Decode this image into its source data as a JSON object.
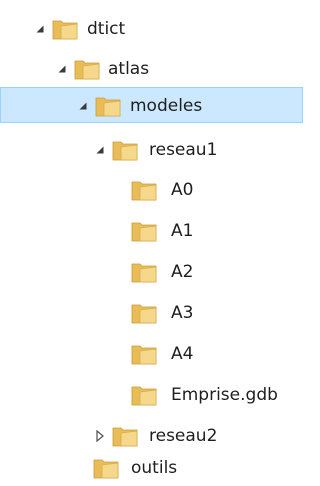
{
  "tree": {
    "colors": {
      "selection_fill": "#cce8ff",
      "selection_border": "#99d1ff",
      "folder": "#e8bd58",
      "folder_front": "#f5d88b",
      "text": "#1e1e1e"
    },
    "items": [
      {
        "label": "dtict",
        "toggle": "expanded",
        "selected": false,
        "icon": "folder-icon"
      },
      {
        "label": "atlas",
        "toggle": "expanded",
        "selected": false,
        "icon": "folder-icon"
      },
      {
        "label": "modeles",
        "toggle": "expanded",
        "selected": true,
        "icon": "folder-icon"
      },
      {
        "label": "reseau1",
        "toggle": "expanded",
        "selected": false,
        "icon": "folder-icon"
      },
      {
        "label": "A0",
        "toggle": "none",
        "selected": false,
        "icon": "folder-icon"
      },
      {
        "label": "A1",
        "toggle": "none",
        "selected": false,
        "icon": "folder-icon"
      },
      {
        "label": "A2",
        "toggle": "none",
        "selected": false,
        "icon": "folder-icon"
      },
      {
        "label": "A3",
        "toggle": "none",
        "selected": false,
        "icon": "folder-icon"
      },
      {
        "label": "A4",
        "toggle": "none",
        "selected": false,
        "icon": "folder-icon"
      },
      {
        "label": "Emprise.gdb",
        "toggle": "none",
        "selected": false,
        "icon": "folder-icon"
      },
      {
        "label": "reseau2",
        "toggle": "collapsed",
        "selected": false,
        "icon": "folder-icon"
      },
      {
        "label": "outils",
        "toggle": "none",
        "selected": false,
        "icon": "folder-icon"
      }
    ]
  }
}
